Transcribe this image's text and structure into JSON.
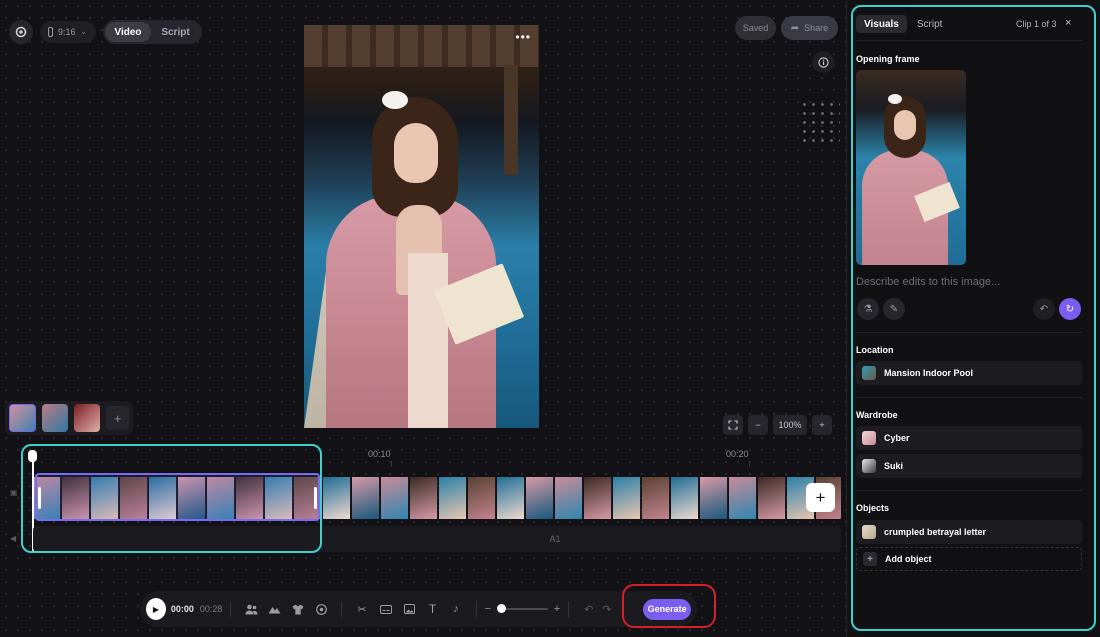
{
  "header": {
    "aspect_ratio": "9:16",
    "mode_tabs": [
      {
        "label": "Video",
        "active": true
      },
      {
        "label": "Script",
        "active": false
      }
    ],
    "saved_label": "Saved",
    "share_label": "Share"
  },
  "preview": {
    "menu_glyph": "•••",
    "zoom_level": "100%",
    "zoom_out_glyph": "−",
    "zoom_in_glyph": "+"
  },
  "scenes": {
    "add_glyph": "+"
  },
  "timeline": {
    "ticks": [
      "00:10",
      "00:20"
    ],
    "audio_track_label": "A1",
    "add_clip_glyph": "+"
  },
  "toolbar": {
    "current_time": "00:00",
    "total_time": "00:28",
    "generate_label": "Generate",
    "zoom_minus": "−",
    "zoom_plus": "+"
  },
  "panel": {
    "tabs": [
      {
        "label": "Visuals",
        "active": true
      },
      {
        "label": "Script",
        "active": false
      }
    ],
    "clip_counter": "Clip 1 of 3",
    "close_glyph": "×",
    "opening_frame_title": "Opening frame",
    "edit_placeholder": "Describe edits to this image...",
    "location_title": "Location",
    "location": "Mansion Indoor Pool",
    "wardrobe_title": "Wardrobe",
    "wardrobe": [
      "Cyber",
      "Suki"
    ],
    "objects_title": "Objects",
    "objects": [
      "crumpled betrayal letter"
    ],
    "add_object_label": "Add object",
    "add_object_glyph": "+"
  },
  "colors": {
    "accent": "#7b5df0",
    "highlight_cyan": "#3fd0d0",
    "highlight_red": "#d4202a",
    "clip_select": "#7a6cf0"
  },
  "icons": {
    "logo": "gear-icon",
    "info": "info-icon",
    "share": "share-arrow-icon",
    "fullscreen": "fullscreen-icon",
    "characters": "users-icon",
    "location": "mountain-icon",
    "wardrobe": "shirt-icon",
    "objects": "ball-icon",
    "cut": "scissors-icon",
    "caption": "caption-icon",
    "image": "image-icon",
    "text": "text-icon",
    "music": "music-icon",
    "undo": "undo-icon",
    "redo": "redo-icon",
    "ai_edit": "magic-icon",
    "erase": "eraser-icon",
    "regenerate": "refresh-icon"
  }
}
